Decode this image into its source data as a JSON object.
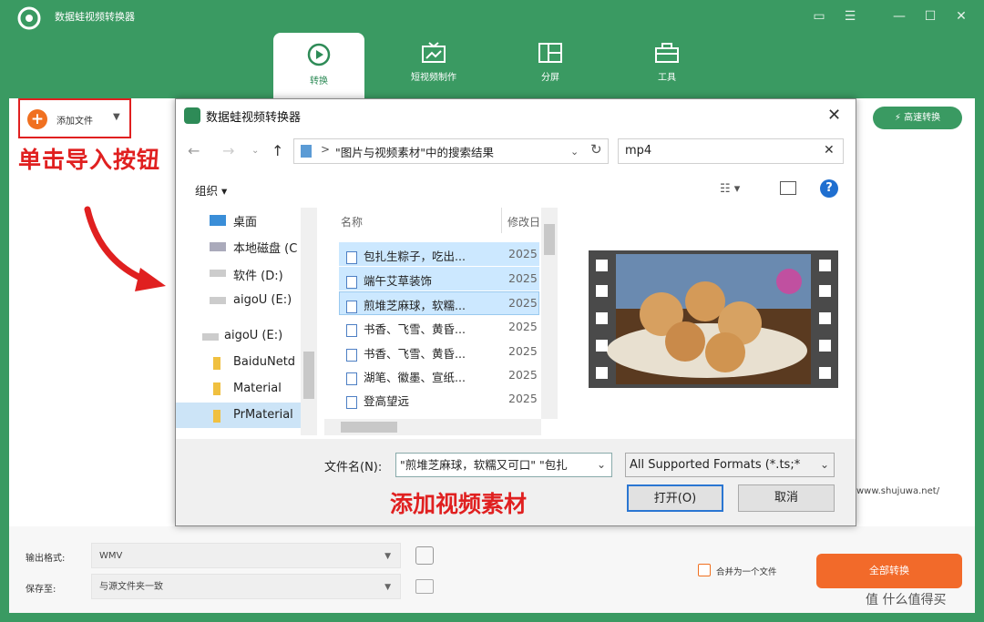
{
  "app": {
    "title": "数据蛙视频转换器"
  },
  "nav_tabs": [
    {
      "label": "转换"
    },
    {
      "label": "短视频制作"
    },
    {
      "label": "分屏"
    },
    {
      "label": "工具"
    }
  ],
  "toolbar": {
    "add_file": "添加文件",
    "high_speed": "高速转换"
  },
  "annotations": {
    "import_hint": "单击导入按钮",
    "add_hint": "添加视频素材",
    "watermark": "www.shujuwa.net/"
  },
  "bottom": {
    "output_format_label": "输出格式:",
    "output_format_value": "WMV",
    "save_to_label": "保存至:",
    "save_to_value": "与源文件夹一致",
    "merge_label": "合并为一个文件",
    "convert_all": "全部转换"
  },
  "dialog": {
    "title": "数据蛙视频转换器",
    "path": "\"图片与视频素材\"中的搜索结果",
    "search": "mp4",
    "organize": "组织",
    "tree": [
      "桌面",
      "本地磁盘 (C",
      "软件 (D:)",
      "aigoU (E:)",
      "aigoU (E:)",
      "BaiduNetd",
      "Material",
      "PrMaterial"
    ],
    "columns": {
      "name": "名称",
      "date": "修改日"
    },
    "files": [
      {
        "name": "包扎生粽子，吃出...",
        "date": "2025"
      },
      {
        "name": "端午艾草装饰",
        "date": "2025"
      },
      {
        "name": "煎堆芝麻球，软糯...",
        "date": "2025"
      },
      {
        "name": "书香、飞雪、黄昏...",
        "date": "2025"
      },
      {
        "name": "书香、飞雪、黄昏...",
        "date": "2025"
      },
      {
        "name": "湖笔、徽墨、宣纸...",
        "date": "2025"
      },
      {
        "name": "登高望远",
        "date": "2025"
      }
    ],
    "filename_label": "文件名(N):",
    "filename_value": "\"煎堆芝麻球，软糯又可口\" \"包扎",
    "format_value": "All Supported Formats (*.ts;*",
    "open_button": "打开(O)",
    "cancel_button": "取消"
  },
  "watermark_brand": "值 什么值得买",
  "colors": {
    "brand_green": "#3a9a62",
    "accent_orange": "#f26a2a",
    "annotation_red": "#e02020",
    "selection_blue": "#cce8ff"
  }
}
